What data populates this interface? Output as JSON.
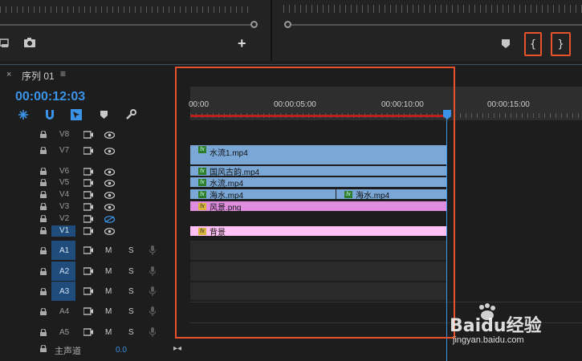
{
  "source_monitor": {
    "add_label": "+"
  },
  "program_monitor": {
    "mark_in_label": "{",
    "mark_out_label": "}"
  },
  "sequence": {
    "tab_label": "序列 01",
    "menu_icon": "≡",
    "close_icon": "×",
    "timecode": "00:00:12:03"
  },
  "ruler": {
    "ticks": [
      "00:00",
      "00:00:05:00",
      "00:00:10:00",
      "00:00:15:00"
    ]
  },
  "video_tracks": [
    {
      "name": "V8"
    },
    {
      "name": "V7"
    },
    {
      "name": "V6"
    },
    {
      "name": "V5"
    },
    {
      "name": "V4"
    },
    {
      "name": "V3"
    },
    {
      "name": "V2"
    },
    {
      "name": "V1"
    }
  ],
  "audio_tracks": [
    {
      "name": "A1",
      "m": "M",
      "s": "S"
    },
    {
      "name": "A2",
      "m": "M",
      "s": "S"
    },
    {
      "name": "A3",
      "m": "M",
      "s": "S"
    },
    {
      "name": "A4",
      "m": "M",
      "s": "S"
    },
    {
      "name": "A5",
      "m": "M",
      "s": "S"
    }
  ],
  "master": {
    "label": "主声道",
    "value": "0.0"
  },
  "clips": {
    "v7": "水流1.mp4",
    "v6": "国风古韵.mp4",
    "v5": "水流.mp4",
    "v4a": "海水.mp4",
    "v4b": "海水.mp4",
    "v3": "风景.png",
    "v1": "背景",
    "fx": "fx"
  },
  "watermark": {
    "brand": "Baidu经验",
    "url": "jingyan.baidu.com"
  },
  "colors": {
    "timecode": "#3a93e6",
    "highlight": "#e5532d",
    "video_clip": "#7aa7d6",
    "image_clip": "#e08de0",
    "bg_clip": "#ffc0f5"
  }
}
